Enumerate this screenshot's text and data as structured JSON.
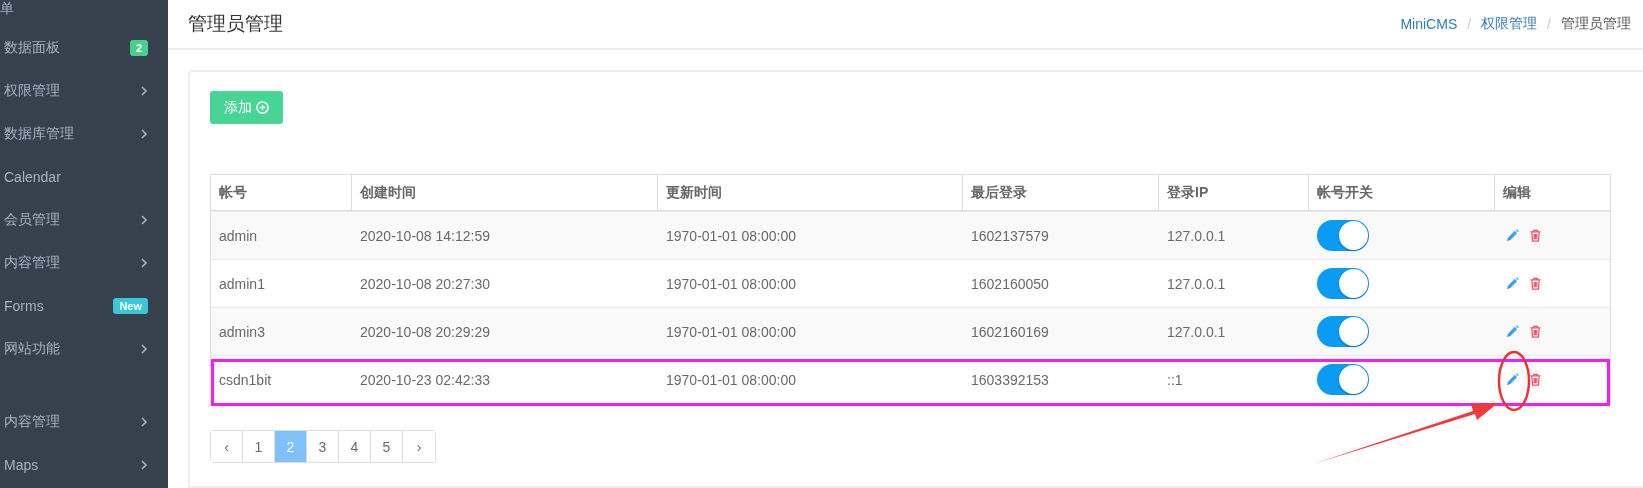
{
  "sidebar": {
    "heading": "单",
    "items": [
      {
        "label": "数据面板",
        "kind": "badge",
        "badge": "2",
        "color": "#48cf8e"
      },
      {
        "label": "权限管理",
        "kind": "submenu"
      },
      {
        "label": "数据库管理",
        "kind": "submenu"
      },
      {
        "label": "Calendar",
        "kind": "plain"
      },
      {
        "label": "会员管理",
        "kind": "submenu"
      },
      {
        "label": "内容管理",
        "kind": "submenu"
      },
      {
        "label": "Forms",
        "kind": "badge",
        "badge": "New",
        "color": "#3ac7d8"
      },
      {
        "label": "网站功能",
        "kind": "submenu"
      }
    ],
    "items_2": [
      {
        "label": "内容管理",
        "kind": "submenu"
      },
      {
        "label": "Maps",
        "kind": "submenu"
      }
    ]
  },
  "page_title": "管理员管理",
  "breadcrumb": [
    {
      "label": "MiniCMS",
      "link": true
    },
    {
      "label": "权限管理",
      "link": true
    },
    {
      "label": "管理员管理",
      "link": false
    }
  ],
  "breadcrumb_separator": "/",
  "add_button": {
    "label": "添加"
  },
  "table": {
    "columns": [
      "帐号",
      "创建时间",
      "更新时间",
      "最后登录",
      "登录IP",
      "帐号开关",
      "编辑"
    ],
    "rows": [
      {
        "cells": [
          "admin",
          "2020-10-08 14:12:59",
          "1970-01-01 08:00:00",
          "1602137579",
          "127.0.0.1"
        ],
        "on": true,
        "annotated": false
      },
      {
        "cells": [
          "admin1",
          "2020-10-08 20:27:30",
          "1970-01-01 08:00:00",
          "1602160050",
          "127.0.0.1"
        ],
        "on": true,
        "annotated": false
      },
      {
        "cells": [
          "admin3",
          "2020-10-08 20:29:29",
          "1970-01-01 08:00:00",
          "1602160169",
          "127.0.0.1"
        ],
        "on": true,
        "annotated": false
      },
      {
        "cells": [
          "csdn1bit",
          "2020-10-23 02:42:33",
          "1970-01-01 08:00:00",
          "1603392153",
          "::1"
        ],
        "on": true,
        "annotated": true
      }
    ]
  },
  "pagination": {
    "prev": "‹",
    "next": "›",
    "pages": [
      {
        "label": "1",
        "selected": false
      },
      {
        "label": "2",
        "selected": true
      },
      {
        "label": "3",
        "selected": false
      },
      {
        "label": "4",
        "selected": false
      },
      {
        "label": "5",
        "selected": false
      }
    ]
  }
}
